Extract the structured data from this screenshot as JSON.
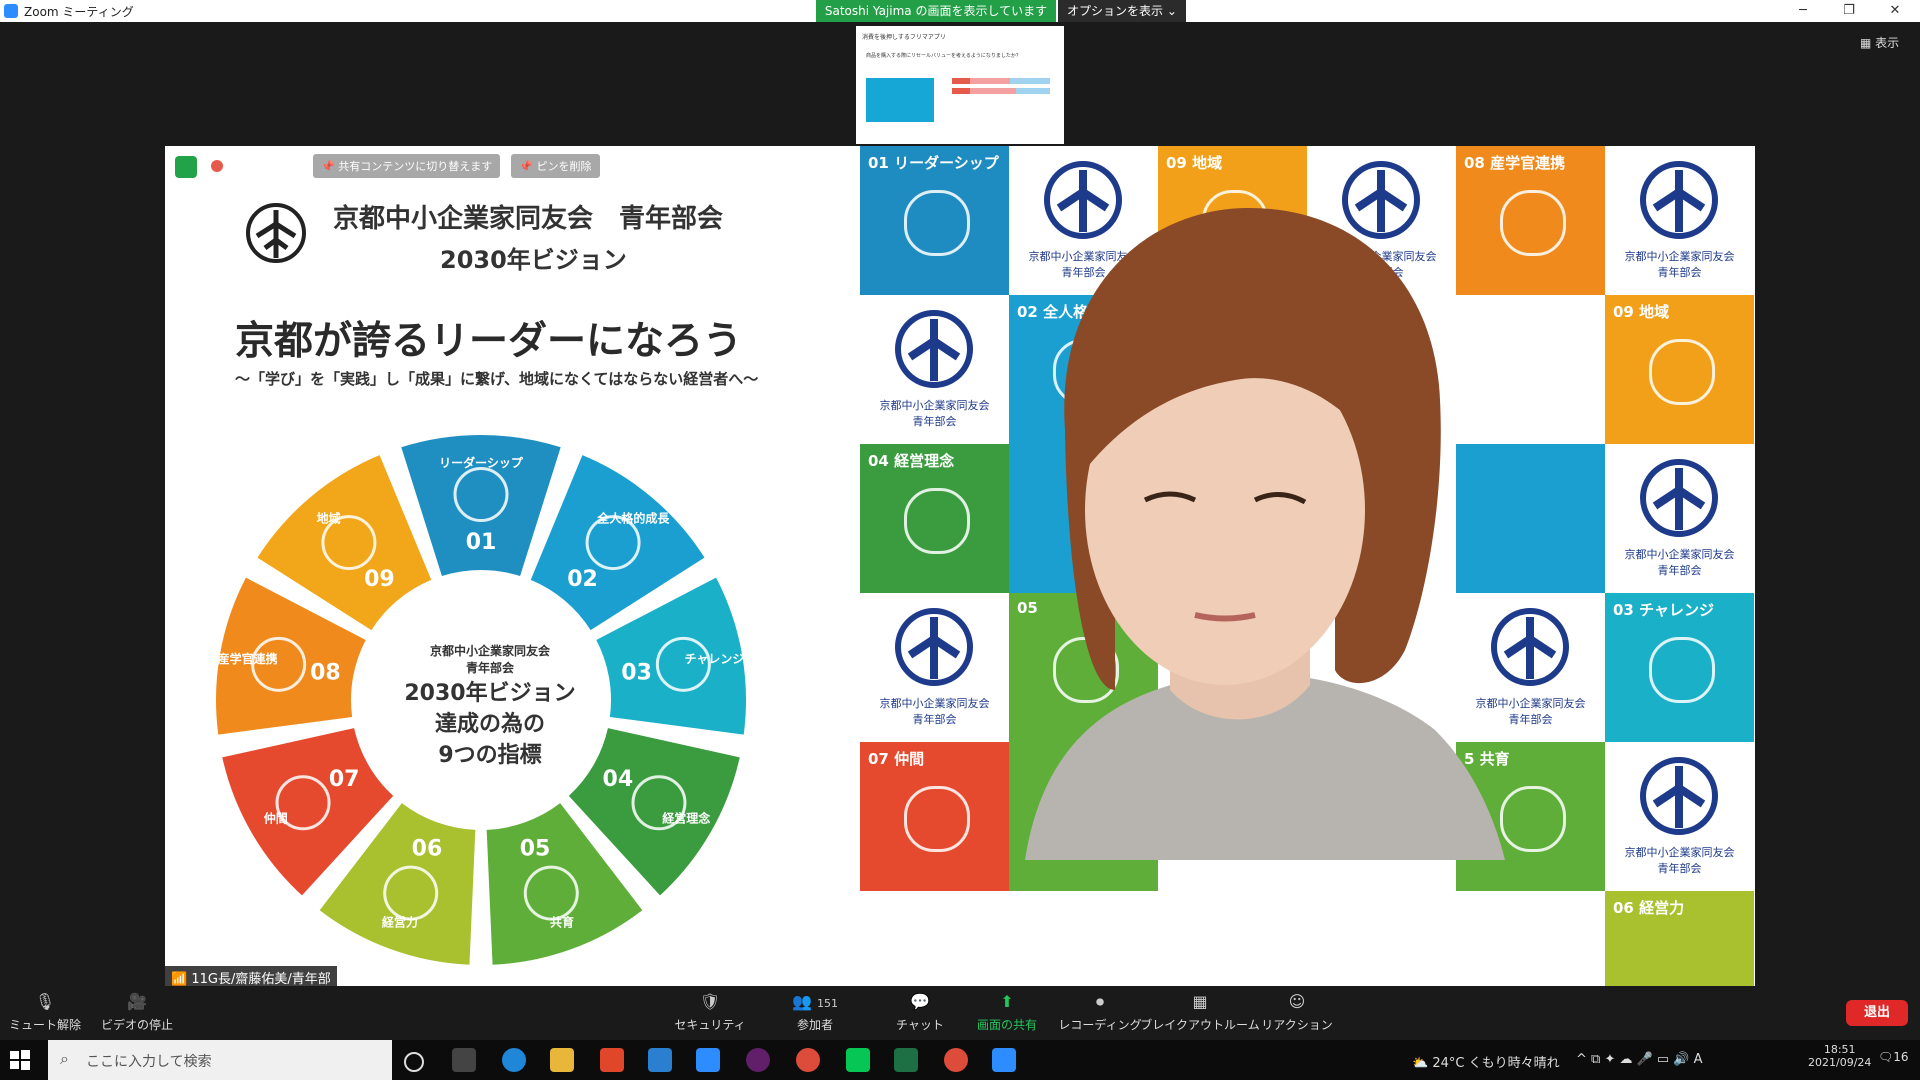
{
  "window": {
    "title": "Zoom ミーティング",
    "share_banner": "Satoshi Yajima の画面を表示しています",
    "options_label": "オプションを表示",
    "view_label": "表示"
  },
  "thumbnail": {
    "title": "消費を後押しするフリマアプリ",
    "question": "商品を購入する際にリセールバリューを考えるようになりましたか？"
  },
  "video": {
    "pin_switch_label": "共有コンテンツに切り替えます",
    "pin_remove_label": "ピンを削除",
    "name_label": "11G長/齋藤佑美/青年部"
  },
  "slide": {
    "org_title": "京都中小企業家同友会　青年部会",
    "vision_title": "2030年ビジョン",
    "headline": "京都が誇るリーダーになろう",
    "subline": "～「学び」を「実践」し「成果」に繋げ、地域になくてはならない経営者へ～",
    "center_small": [
      "京都中小企業家同友会",
      "青年部会"
    ],
    "center_large": [
      "2030年ビジョン",
      "達成の為の",
      "9つの指標"
    ],
    "segments": [
      {
        "num": "01",
        "label": "リーダーシップ",
        "color": "#1f8fc2"
      },
      {
        "num": "02",
        "label": "全人格的成長",
        "color": "#1a9fd0"
      },
      {
        "num": "03",
        "label": "チャレンジ",
        "color": "#1ab0c8"
      },
      {
        "num": "04",
        "label": "経営理念",
        "color": "#3a9c3e"
      },
      {
        "num": "05",
        "label": "共育",
        "color": "#5fae3a"
      },
      {
        "num": "06",
        "label": "経営力",
        "color": "#a9c02f"
      },
      {
        "num": "07",
        "label": "仲間",
        "color": "#e64a2e"
      },
      {
        "num": "08",
        "label": "産学官連携",
        "color": "#f08a1c"
      },
      {
        "num": "09",
        "label": "地域",
        "color": "#f2a61a"
      }
    ]
  },
  "backdrop": {
    "logo_text": [
      "京都中小企業家同友会",
      "青年部会"
    ],
    "tiles": [
      {
        "kind": "seg",
        "num": "01",
        "label": "リーダーシップ",
        "color": "#1e8cc0"
      },
      {
        "kind": "logo"
      },
      {
        "kind": "seg",
        "num": "09",
        "label": "地域",
        "color": "#f2a01a"
      },
      {
        "kind": "logo"
      },
      {
        "kind": "seg",
        "num": "08",
        "label": "産学官連携",
        "color": "#f08a1c"
      },
      {
        "kind": "logo"
      },
      {
        "kind": "logo"
      },
      {
        "kind": "seg",
        "num": "02",
        "label": "全人格",
        "color": "#1a9fd0"
      },
      {
        "kind": "logo"
      },
      {
        "kind": "logo"
      },
      {
        "kind": "seg",
        "num": "",
        "label": "",
        "color": "#fff"
      },
      {
        "kind": "seg",
        "num": "09",
        "label": "地域",
        "color": "#f2a01a"
      },
      {
        "kind": "seg",
        "num": "04",
        "label": "経営理念",
        "color": "#3a9c3e"
      },
      {
        "kind": "seg",
        "num": "",
        "label": "",
        "color": "#1a9fd0"
      },
      {
        "kind": "seg",
        "num": "",
        "label": "",
        "color": "#fff"
      },
      {
        "kind": "seg",
        "num": "",
        "label": "",
        "color": "#fff"
      },
      {
        "kind": "seg",
        "num": "",
        "label": "",
        "color": "#1a9fd0"
      },
      {
        "kind": "logo"
      },
      {
        "kind": "logo"
      },
      {
        "kind": "seg",
        "num": "05",
        "label": "",
        "color": "#5fae3a"
      },
      {
        "kind": "seg",
        "num": "",
        "label": "",
        "color": "#fff"
      },
      {
        "kind": "seg",
        "num": "",
        "label": "",
        "color": "#fff"
      },
      {
        "kind": "logo"
      },
      {
        "kind": "seg",
        "num": "03",
        "label": "チャレンジ",
        "color": "#1ab0c8"
      },
      {
        "kind": "seg",
        "num": "07",
        "label": "仲間",
        "color": "#e64a2e"
      },
      {
        "kind": "seg",
        "num": "",
        "label": "",
        "color": "#5fae3a"
      },
      {
        "kind": "seg",
        "num": "",
        "label": "",
        "color": "#fff"
      },
      {
        "kind": "seg",
        "num": "",
        "label": "",
        "color": "#fff"
      },
      {
        "kind": "seg",
        "num": "5",
        "label": "共育",
        "color": "#5fae3a"
      },
      {
        "kind": "logo"
      }
    ],
    "bottom_right_label": "06 経営力"
  },
  "toolbar": {
    "mute": "ミュート解除",
    "video": "ビデオの停止",
    "security": "セキュリティ",
    "participants": "参加者",
    "participants_count": "151",
    "chat": "チャット",
    "share": "画面の共有",
    "record": "レコーディング",
    "breakout": "ブレイクアウトルーム",
    "reactions": "リアクション",
    "leave": "退出"
  },
  "taskbar": {
    "search_placeholder": "ここに入力して検索",
    "weather": "24°C  くもり時々晴れ",
    "time": "18:51",
    "date": "2021/09/24",
    "notif_count": "16"
  },
  "colors": {
    "share_green": "#23a047",
    "leave_red": "#e02828",
    "zoom_blue": "#2d8cff"
  }
}
